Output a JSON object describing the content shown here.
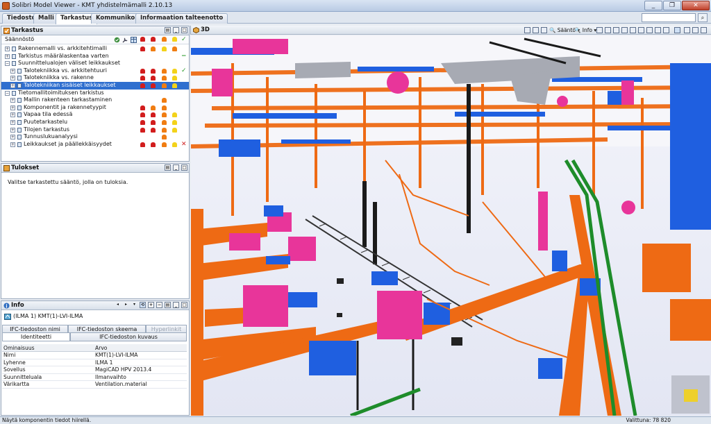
{
  "window": {
    "title": "Solibri Model Viewer - KMT yhdistelmämalli 2.10.13",
    "buttons": [
      "_",
      "❐",
      "✕"
    ]
  },
  "tabs": [
    {
      "label": "Tiedosto",
      "active": false
    },
    {
      "label": "Malli",
      "active": false
    },
    {
      "label": "Tarkastus",
      "active": true
    },
    {
      "label": "Kommunikointi",
      "active": false
    },
    {
      "label": "Informaation talteenotto",
      "active": false
    }
  ],
  "rules_panel": {
    "title": "Tarkastus",
    "column_header": "Säännöstö",
    "rows": [
      {
        "label": "Rakennemalli vs. arkkitehtimalli",
        "level": 0,
        "expand": "+",
        "severities": [
          "r",
          "o",
          "y",
          "o"
        ],
        "status": ""
      },
      {
        "label": "Tarkistus määrälaskentaa varten",
        "level": 0,
        "expand": "+",
        "severities": [],
        "status": "−"
      },
      {
        "label": "Suunnittelualojen väliset leikkaukset",
        "level": 0,
        "expand": "−",
        "severities": [],
        "status": ""
      },
      {
        "label": "Talotekniikka vs. arkkitehtuuri",
        "level": 1,
        "expand": "+",
        "severities": [
          "r",
          "r",
          "o",
          "y"
        ],
        "status": "✓"
      },
      {
        "label": "Talotekniikka vs. rakenne",
        "level": 1,
        "expand": "+",
        "severities": [
          "r",
          "r",
          "o",
          "y"
        ],
        "status": ""
      },
      {
        "label": "Talotekniikan sisäiset leikkaukset",
        "level": 1,
        "expand": "+",
        "severities": [
          "r",
          "r",
          "o",
          "y"
        ],
        "status": "",
        "selected": true
      },
      {
        "label": "Tietomallitoimituksen tarkistus",
        "level": 0,
        "expand": "−",
        "severities": [],
        "status": ""
      },
      {
        "label": "Mallin rakenteen tarkastaminen",
        "level": 1,
        "expand": "+",
        "severities": [
          "o"
        ],
        "status": ""
      },
      {
        "label": "Komponentit ja rakennetyypit",
        "level": 1,
        "expand": "+",
        "severities": [
          "r",
          "o",
          "o"
        ],
        "status": ""
      },
      {
        "label": "Vapaa tila edessä",
        "level": 1,
        "expand": "+",
        "severities": [
          "r",
          "r",
          "o",
          "y"
        ],
        "status": ""
      },
      {
        "label": "Puutetarkastelu",
        "level": 1,
        "expand": "+",
        "severities": [
          "r",
          "r",
          "o",
          "y"
        ],
        "status": ""
      },
      {
        "label": "Tilojen tarkastus",
        "level": 1,
        "expand": "+",
        "severities": [
          "r",
          "r",
          "o",
          "y"
        ],
        "status": ""
      },
      {
        "label": "Tunnuslukuanalyysi",
        "level": 1,
        "expand": "+",
        "severities": [
          "o"
        ],
        "status": ""
      },
      {
        "label": "Leikkaukset ja päällekkäisyydet",
        "level": 1,
        "expand": "+",
        "severities": [
          "r",
          "r",
          "o",
          "y"
        ],
        "status": "✕"
      }
    ]
  },
  "results_panel": {
    "title": "Tulokset",
    "message": "Valitse tarkastettu sääntö, jolla on tuloksia."
  },
  "info_panel": {
    "title": "Info",
    "component": "(ILMA 1) KMT(1)-LVI-ILMA",
    "tabs_row1": [
      "IFC-tiedoston nimi",
      "IFC-tiedoston skeema",
      "Hyperlinkit"
    ],
    "tabs_row2": [
      "Identiteetti",
      "IFC-tiedoston kuvaus"
    ],
    "table_header": [
      "Ominaisuus",
      "Arvo"
    ],
    "properties": [
      {
        "name": "Nimi",
        "value": "KMT(1)-LVI-ILMA"
      },
      {
        "name": "Lyhenne",
        "value": "ILMA 1"
      },
      {
        "name": "Sovellus",
        "value": "MagiCAD HPV 2013.4"
      },
      {
        "name": "Suunnitteluala",
        "value": "Ilmanvaihto"
      },
      {
        "name": "Värikartta",
        "value": "Ventilation.material"
      }
    ]
  },
  "view3d": {
    "title": "3D",
    "toolbar": {
      "rule_label": "Sääntö",
      "info_label": "Info"
    }
  },
  "statusbar": {
    "left": "Näytä komponentin tiedot hiirellä.",
    "right": "Valittuna: 78 820"
  },
  "colors": {
    "duct": "#ee6a14",
    "pipe_blue": "#1f5fe0",
    "magenta": "#e8359a",
    "selection": "#2f6fcf"
  }
}
